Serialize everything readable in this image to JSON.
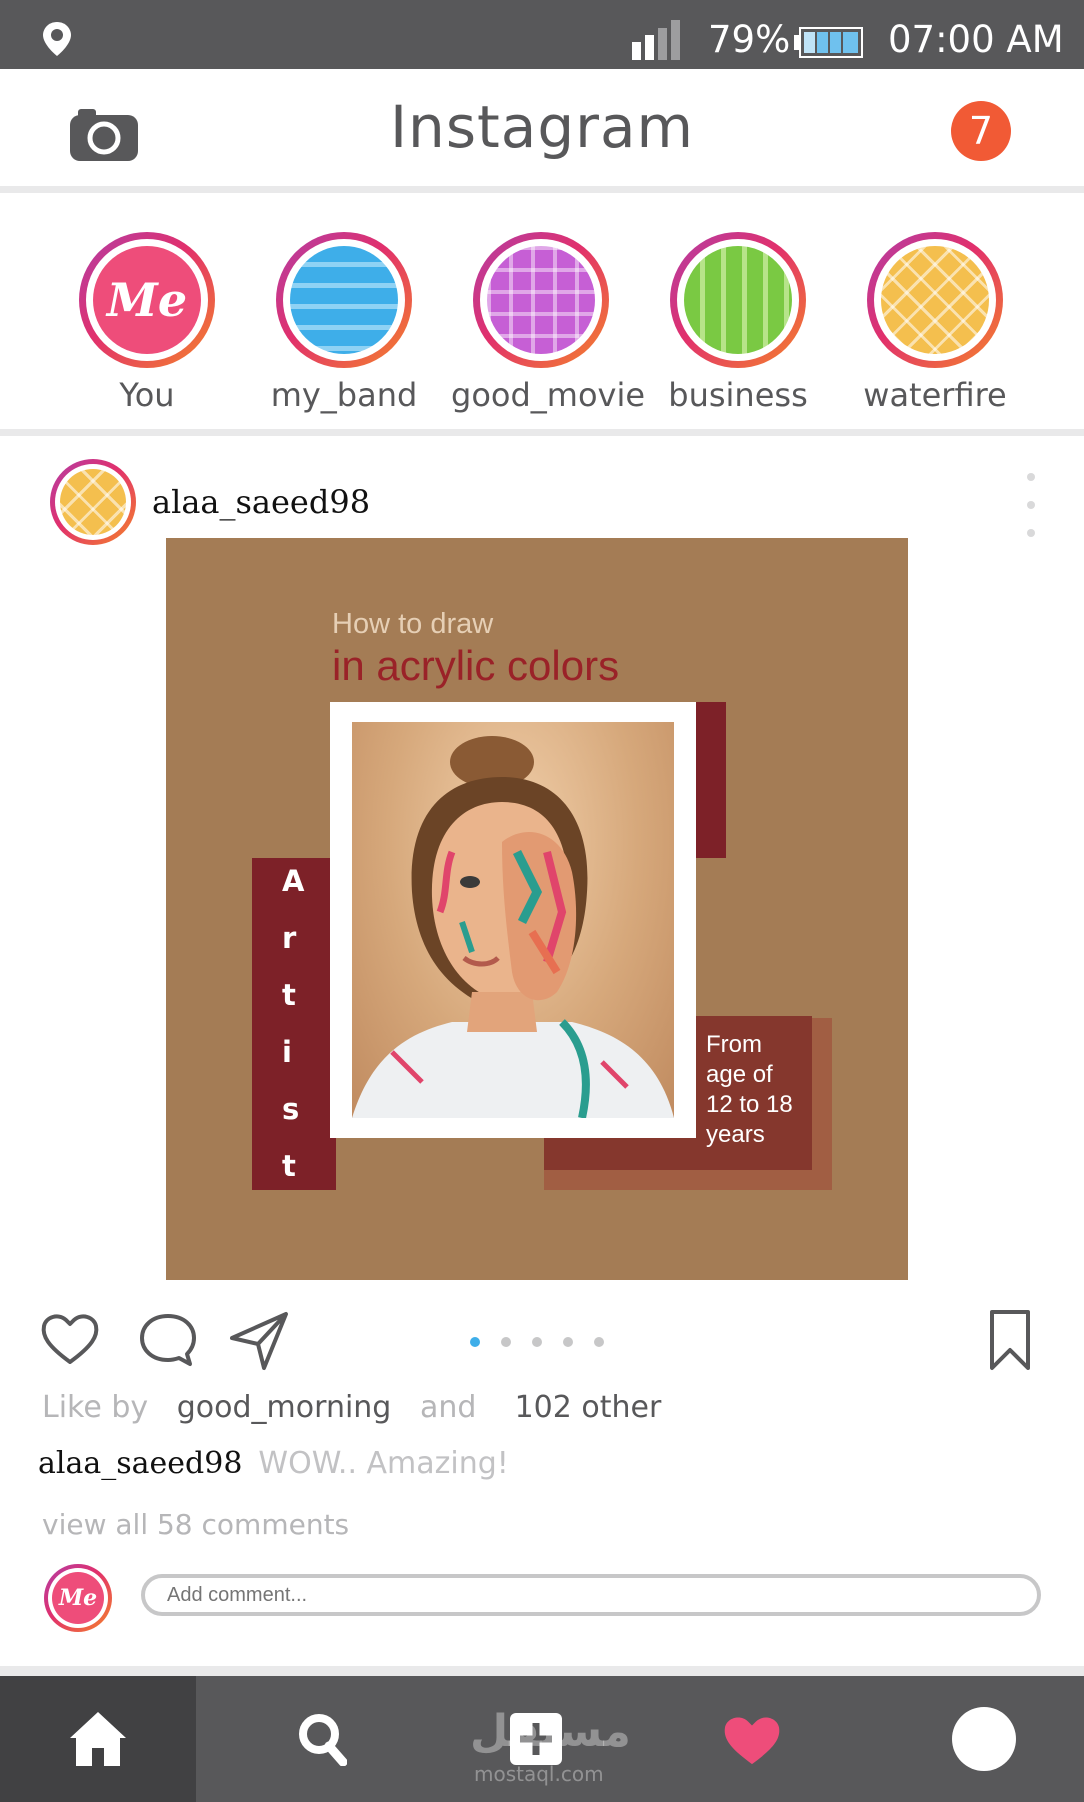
{
  "status_bar": {
    "battery_percent": "79%",
    "time": "07:00 AM"
  },
  "header": {
    "title": "Instagram",
    "notification_count": "7"
  },
  "stories": [
    {
      "label": "You",
      "avatar_text": "Me"
    },
    {
      "label": "my_band"
    },
    {
      "label": "good_movie"
    },
    {
      "label": "business"
    },
    {
      "label": "waterfire"
    }
  ],
  "post": {
    "username": "alaa_saeed98",
    "image": {
      "subtitle": "How to draw",
      "title": "in acrylic colors",
      "vertical_letters": [
        "A",
        "r",
        "t",
        "i",
        "s",
        "t"
      ],
      "age_text_lines": [
        "From",
        "age of",
        "12 to 18",
        "years"
      ]
    },
    "carousel_dots": 5,
    "likes": {
      "prefix": "Like by",
      "user": "good_morning",
      "conj": "and",
      "others": "102 other"
    },
    "caption": {
      "user": "alaa_saeed98",
      "text": "WOW.. Amazing!"
    },
    "view_comments": "view all 58 comments",
    "comment_placeholder": "Add comment...",
    "comment_avatar_text": "Me"
  },
  "watermark": {
    "text": "مستقل",
    "sub": "mostaql.com"
  },
  "colors": {
    "status_bar": "#58585a",
    "notification": "#f15a35",
    "like_heart": "#ee4d7a",
    "dot_active": "#3eaee9",
    "post_bg": "#a47c55",
    "accent_red": "#7d2128"
  }
}
